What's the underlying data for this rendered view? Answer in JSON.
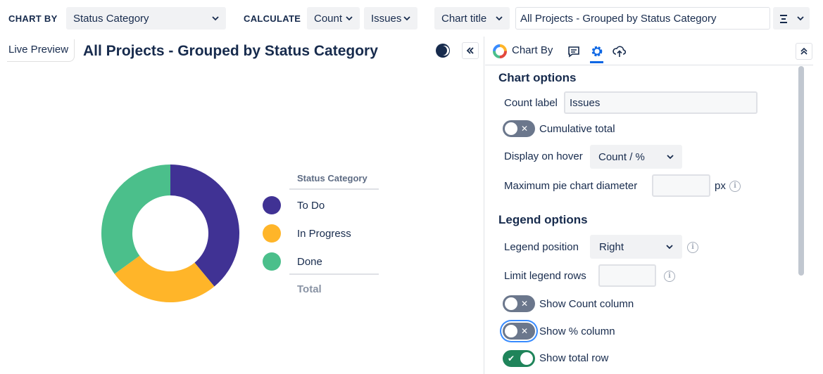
{
  "toolbar": {
    "chart_by_label": "CHART BY",
    "chart_by_value": "Status Category",
    "calculate_label": "CALCULATE",
    "calc_metric": "Count",
    "calc_target": "Issues",
    "chart_title_mode": "Chart title",
    "chart_title_value": "All Projects - Grouped by Status Category"
  },
  "preview": {
    "tab_label": "Live Preview",
    "title": "All Projects - Grouped by Status Category"
  },
  "legend": {
    "header": "Status Category",
    "items": [
      {
        "label": "To Do",
        "color": "#403294"
      },
      {
        "label": "In Progress",
        "color": "#ffb529"
      },
      {
        "label": "Done",
        "color": "#4bbf8b"
      }
    ],
    "total_label": "Total"
  },
  "chart_data": {
    "type": "pie",
    "title": "All Projects - Grouped by Status Category",
    "categories": [
      "To Do",
      "In Progress",
      "Done"
    ],
    "values": [
      39,
      26,
      35
    ],
    "colors": [
      "#403294",
      "#ffb529",
      "#4bbf8b"
    ],
    "legend_position": "right",
    "donut": true
  },
  "panel": {
    "tab_chart_by": "Chart By",
    "chart_options_title": "Chart options",
    "count_label_label": "Count label",
    "count_label_value": "Issues",
    "cumulative_total_label": "Cumulative total",
    "display_on_hover_label": "Display on hover",
    "display_on_hover_value": "Count / %",
    "max_pie_diameter_label": "Maximum pie chart diameter",
    "max_pie_diameter_unit": "px",
    "legend_options_title": "Legend options",
    "legend_position_label": "Legend position",
    "legend_position_value": "Right",
    "limit_legend_rows_label": "Limit legend rows",
    "show_count_column_label": "Show Count column",
    "show_percent_column_label": "Show % column",
    "show_total_row_label": "Show total row"
  },
  "colors": {
    "accent": "#0c66e4",
    "toggle_off": "#6b778c",
    "toggle_on": "#1f845a"
  }
}
